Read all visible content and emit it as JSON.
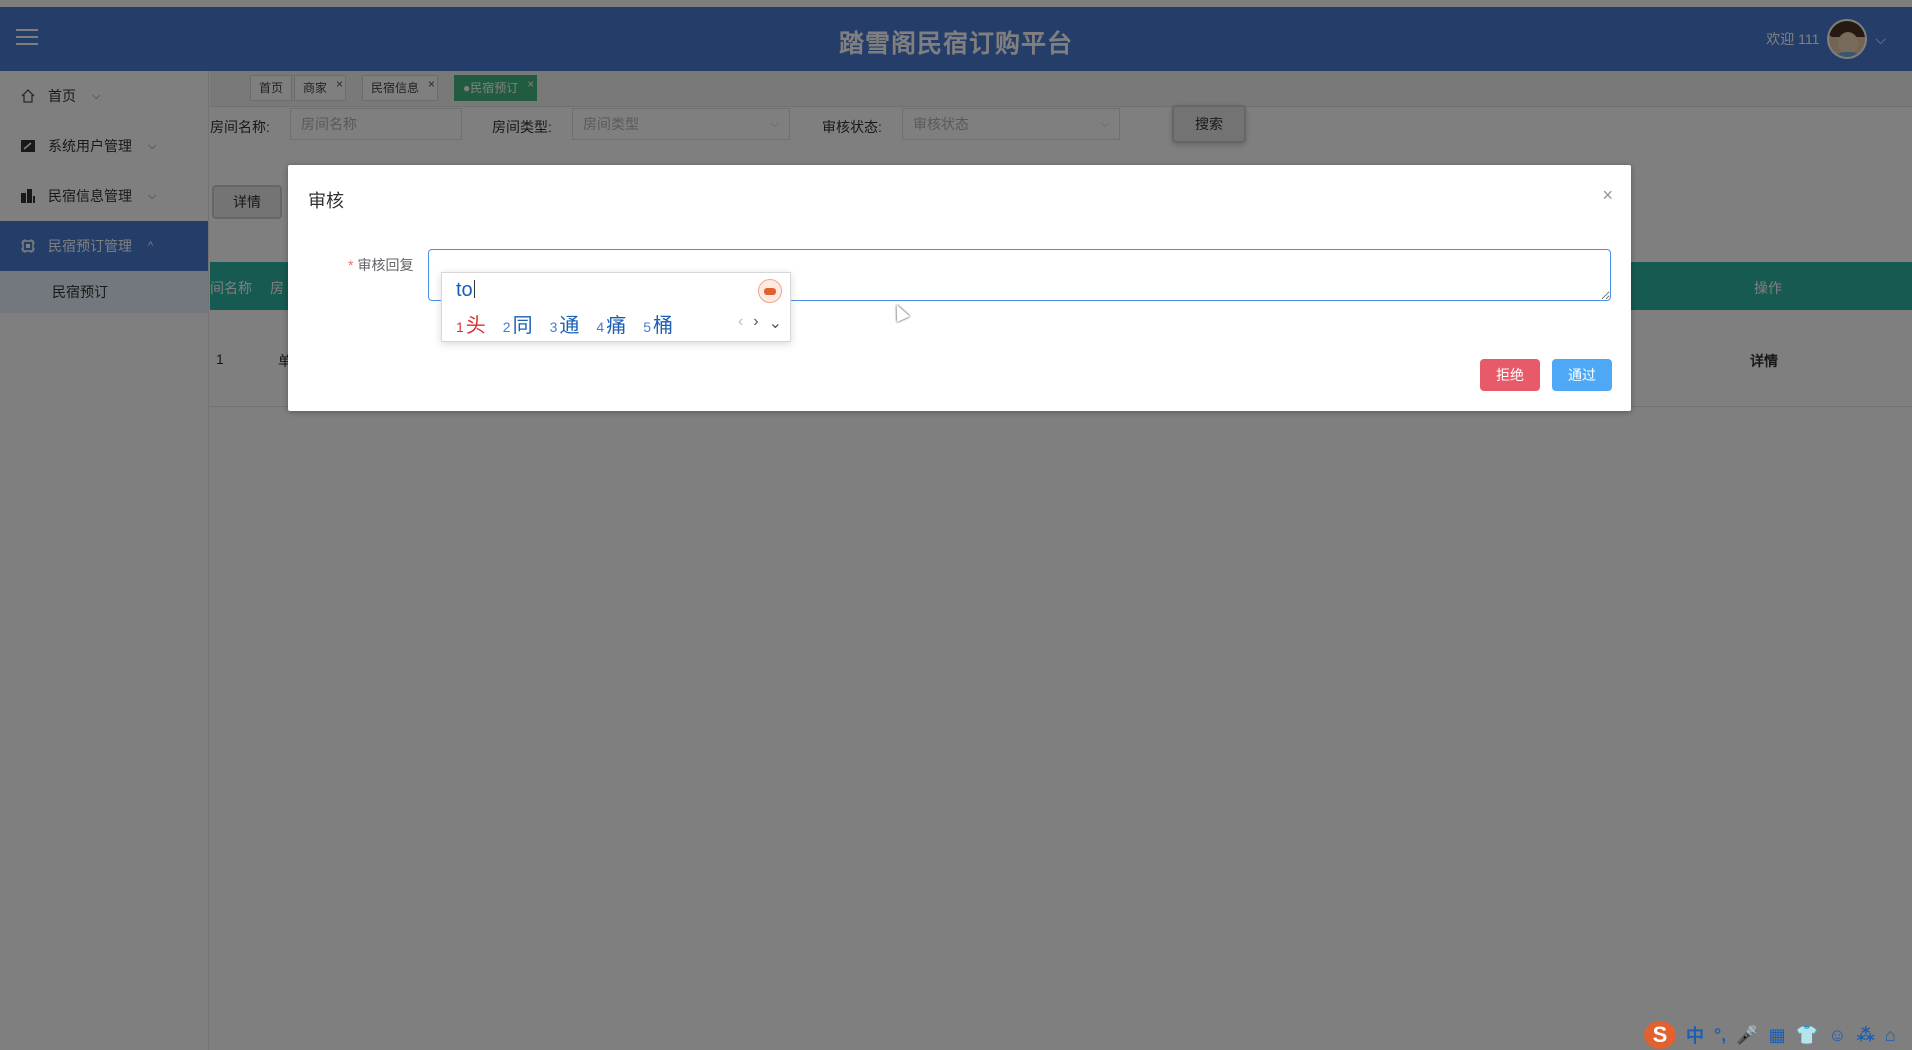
{
  "header": {
    "title": "踏雪阁民宿订购平台",
    "welcome": "欢迎 111",
    "user_chevron": "⌵"
  },
  "sidebar": {
    "items": [
      {
        "label": "首页"
      },
      {
        "label": "系统用户管理"
      },
      {
        "label": "民宿信息管理"
      },
      {
        "label": "民宿预订管理"
      }
    ],
    "sub_item": "民宿预订"
  },
  "tabs": [
    {
      "label": "首页"
    },
    {
      "label": "商家",
      "close": "×"
    },
    {
      "label": "民宿信息",
      "close": "×"
    },
    {
      "label": "●民宿预订",
      "close": "×"
    }
  ],
  "search": {
    "room_name_label": "房间名称:",
    "room_name_placeholder": "房间名称",
    "room_type_label": "房间类型:",
    "room_type_placeholder": "房间类型",
    "audit_label": "审核状态:",
    "audit_placeholder": "审核状态",
    "button": "搜索"
  },
  "toolbar": {
    "detail_button": "详情"
  },
  "table": {
    "headers": {
      "col1": "间名称",
      "col2": "房",
      "ops": "操作"
    },
    "row": {
      "index": "1",
      "col2": "单",
      "ops": "详情"
    }
  },
  "dialog": {
    "title": "审核",
    "close": "×",
    "required_mark": "*",
    "field_label": "审核回复",
    "reply_value": "",
    "reject_button": "拒绝",
    "pass_button": "通过"
  },
  "ime": {
    "composition": "to",
    "candidates": [
      {
        "n": "1",
        "ch": "头"
      },
      {
        "n": "2",
        "ch": "同"
      },
      {
        "n": "3",
        "ch": "通"
      },
      {
        "n": "4",
        "ch": "痛"
      },
      {
        "n": "5",
        "ch": "桶"
      }
    ],
    "prev": "‹",
    "next": "›",
    "expand": "⌄"
  },
  "imebar": {
    "logo": "S",
    "items": [
      "中",
      "°,",
      "🎤",
      "▦",
      "👕",
      "☺",
      "⁂",
      "⌂"
    ]
  }
}
